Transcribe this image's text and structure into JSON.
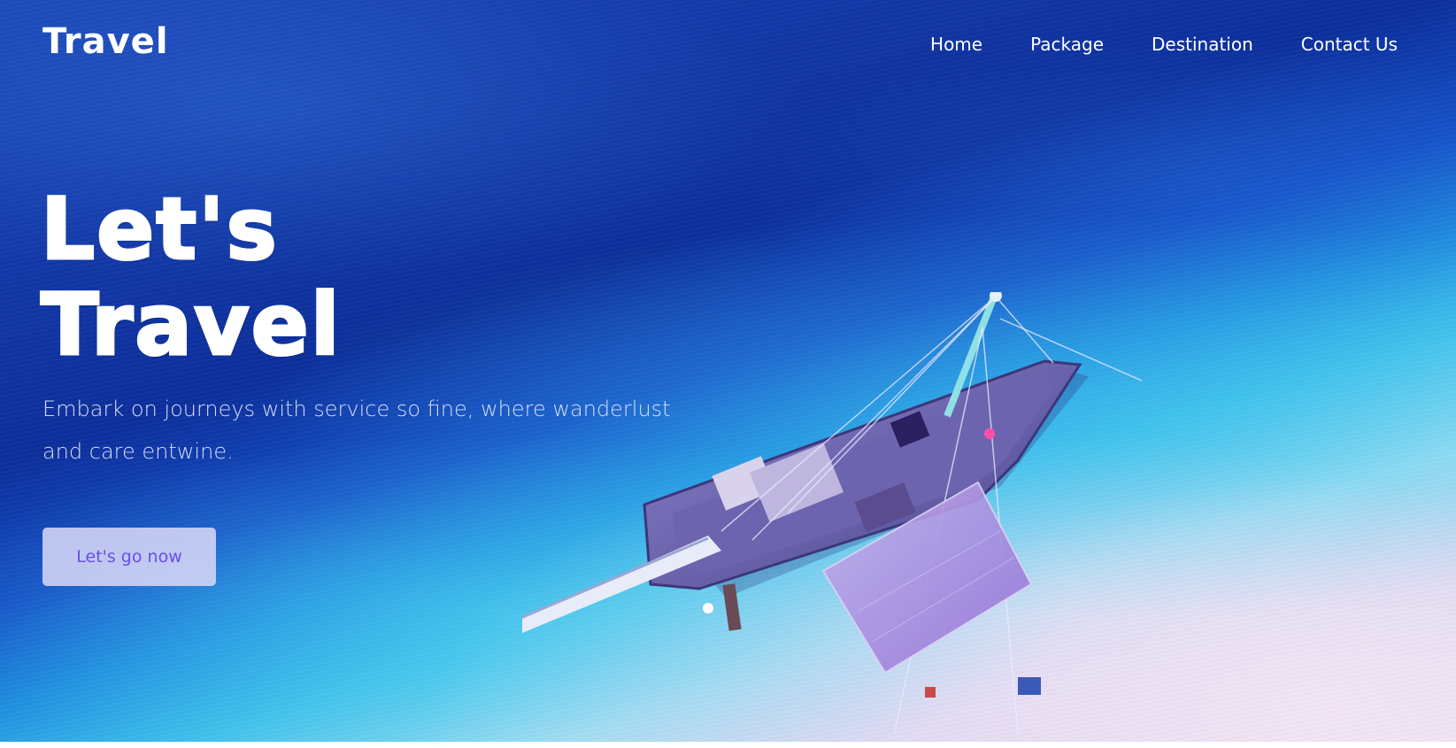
{
  "header": {
    "brand": "Travel",
    "nav": [
      "Home",
      "Package",
      "Destination",
      "Contact Us"
    ]
  },
  "hero": {
    "headline_line1": "Let's",
    "headline_line2": "Travel",
    "tagline_line1": "Embark on journeys with service so fine, where wanderlust",
    "tagline_line2": "and care entwine.",
    "cta_label": "Let's go now"
  },
  "colors": {
    "deep_water": "#0c2f9c",
    "shallow_water": "#3fc1ec",
    "sand": "#efe6f4",
    "cta_background": "#d6d6f6",
    "cta_text": "#6a4ee6",
    "text_primary": "#ffffff"
  },
  "background_image": "aerial-sailboat-beach"
}
